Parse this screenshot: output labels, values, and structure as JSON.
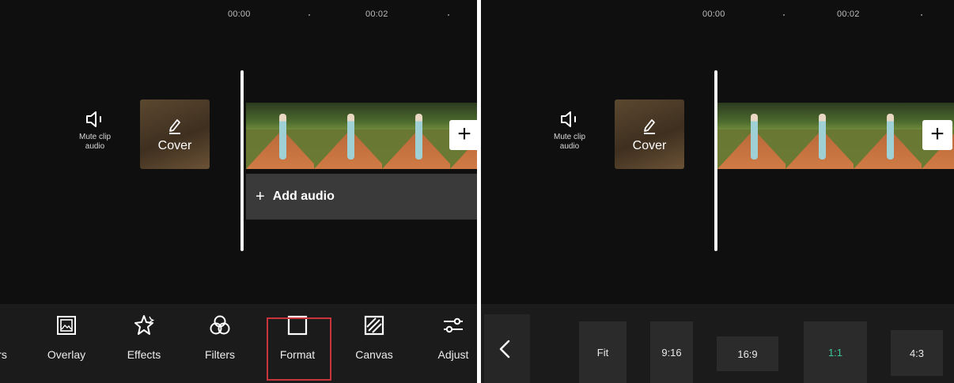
{
  "left_panel": {
    "timeline": {
      "times": [
        "00:00",
        "00:02"
      ]
    },
    "mute": {
      "icon": "speaker-icon",
      "label": "Mute clip audio"
    },
    "cover": {
      "icon": "pencil-icon",
      "label": "Cover"
    },
    "add_clip": {
      "icon": "plus-icon",
      "label": "+"
    },
    "add_audio": {
      "icon": "plus-icon",
      "plus": "+",
      "label": "Add audio"
    },
    "toolbar": {
      "partial_label": "rs",
      "items": [
        {
          "label": "Overlay",
          "icon": "overlay-icon"
        },
        {
          "label": "Effects",
          "icon": "effects-icon"
        },
        {
          "label": "Filters",
          "icon": "filters-icon"
        },
        {
          "label": "Format",
          "icon": "format-icon",
          "highlighted": true
        },
        {
          "label": "Canvas",
          "icon": "canvas-icon"
        },
        {
          "label": "Adjust",
          "icon": "adjust-icon"
        }
      ]
    }
  },
  "right_panel": {
    "timeline": {
      "times": [
        "00:00",
        "00:02"
      ]
    },
    "mute": {
      "icon": "speaker-icon",
      "label": "Mute clip audio"
    },
    "cover": {
      "icon": "pencil-icon",
      "label": "Cover"
    },
    "add_clip": {
      "icon": "plus-icon",
      "label": "+"
    },
    "back": {
      "icon": "chevron-left-icon"
    },
    "ratios": [
      {
        "label": "Fit"
      },
      {
        "label": "9:16"
      },
      {
        "label": "16:9"
      },
      {
        "label": "1:1",
        "selected": true
      },
      {
        "label": "4:3"
      }
    ]
  },
  "colors": {
    "background": "#0f0f0f",
    "toolbar": "#1b1b1b",
    "highlight_border": "#c8343b",
    "selected_ratio": "#39c89c"
  }
}
